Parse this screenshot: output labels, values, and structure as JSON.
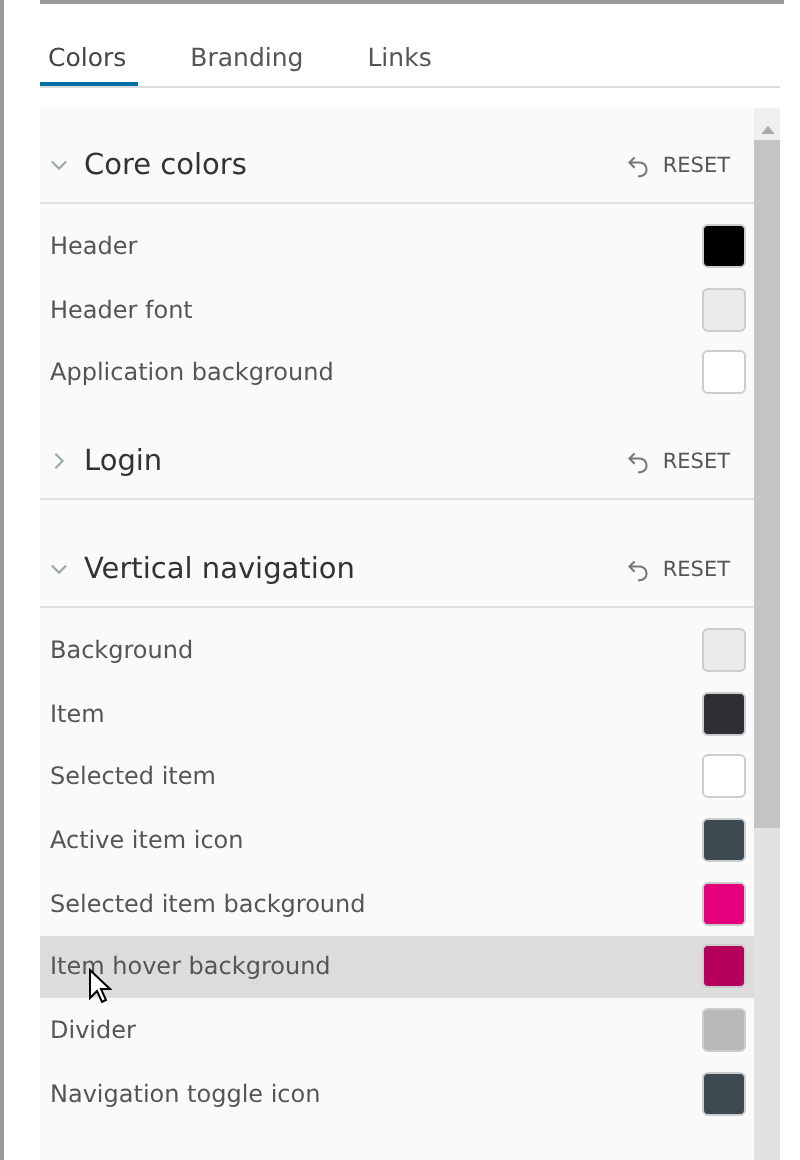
{
  "tabs": [
    {
      "label": "Colors",
      "selected": true
    },
    {
      "label": "Branding",
      "selected": false
    },
    {
      "label": "Links",
      "selected": false
    }
  ],
  "sections": [
    {
      "title": "Core colors",
      "expanded": true,
      "reset": "RESET",
      "items": [
        {
          "label": "Header",
          "color": "#000000",
          "hovered": false
        },
        {
          "label": "Header font",
          "color": "#e8eaec",
          "hovered": false
        },
        {
          "label": "Application background",
          "color": "#ffffff",
          "hovered": false
        }
      ]
    },
    {
      "title": "Login",
      "expanded": false,
      "reset": "RESET"
    },
    {
      "title": "Vertical navigation",
      "expanded": true,
      "reset": "RESET",
      "items": [
        {
          "label": "Background",
          "color": "#e8ebea",
          "hovered": false
        },
        {
          "label": "Item",
          "color": "#2e3035",
          "hovered": false
        },
        {
          "label": "Selected item",
          "color": "#ffffff",
          "hovered": false
        },
        {
          "label": "Active item icon",
          "color": "#3d4a52",
          "hovered": false
        },
        {
          "label": "Selected item background",
          "color": "#e4007c",
          "hovered": false
        },
        {
          "label": "Item hover background",
          "color": "#b5005b",
          "hovered": true
        },
        {
          "label": "Divider",
          "color": "#b8b8b8",
          "hovered": false
        },
        {
          "label": "Navigation toggle icon",
          "color": "#3d4a52",
          "hovered": false
        }
      ]
    }
  ]
}
